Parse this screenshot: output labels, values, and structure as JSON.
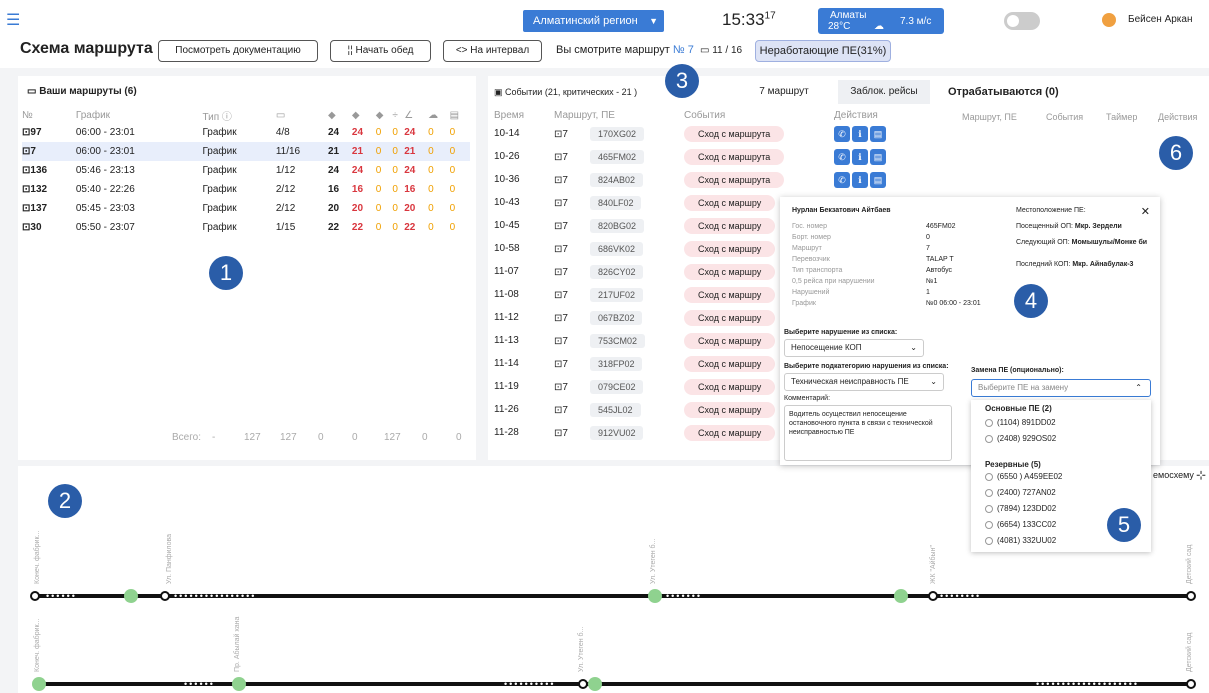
{
  "header": {
    "region": "Алматинский регион",
    "time": "15:33",
    "seconds": "17",
    "weather_city": "Алматы",
    "weather_temp": "28°C",
    "wind": "7.3 м/с",
    "user": "Бейсен Аркан"
  },
  "toolbar": {
    "title": "Схема маршрута",
    "docs": "Посмотреть документацию",
    "lunch": "Начать обед",
    "interval": "На интервал",
    "viewing": "Вы смотрите маршрут",
    "route_no": "№ 7",
    "counter": "11 / 16",
    "nonwork": "Неработающие ПЕ(31%)"
  },
  "routes": {
    "title": "Ваши маршруты (6)",
    "headers": [
      "№",
      "График",
      "Тип",
      "",
      "",
      "",
      "",
      "",
      "",
      "",
      ""
    ],
    "rows": [
      {
        "n": "97",
        "g": "06:00 - 23:01",
        "t": "График",
        "a": "4/8",
        "b": "24",
        "c": "24",
        "d": "0",
        "e": "0",
        "f": "24",
        "h": "0",
        "i": "0"
      },
      {
        "n": "7",
        "g": "06:00 - 23:01",
        "t": "График",
        "a": "11/16",
        "b": "21",
        "c": "21",
        "d": "0",
        "e": "0",
        "f": "21",
        "h": "0",
        "i": "0"
      },
      {
        "n": "136",
        "g": "05:46 - 23:13",
        "t": "График",
        "a": "1/12",
        "b": "24",
        "c": "24",
        "d": "0",
        "e": "0",
        "f": "24",
        "h": "0",
        "i": "0"
      },
      {
        "n": "132",
        "g": "05:40 - 22:26",
        "t": "График",
        "a": "2/12",
        "b": "16",
        "c": "16",
        "d": "0",
        "e": "0",
        "f": "16",
        "h": "0",
        "i": "0"
      },
      {
        "n": "137",
        "g": "05:45 - 23:03",
        "t": "График",
        "a": "2/12",
        "b": "20",
        "c": "20",
        "d": "0",
        "e": "0",
        "f": "20",
        "h": "0",
        "i": "0"
      },
      {
        "n": "30",
        "g": "05:50 - 23:07",
        "t": "График",
        "a": "1/15",
        "b": "22",
        "c": "22",
        "d": "0",
        "e": "0",
        "f": "22",
        "h": "0",
        "i": "0"
      }
    ],
    "totals": [
      "Всего:",
      "-",
      "127",
      "127",
      "0",
      "0",
      "127",
      "0",
      "0"
    ]
  },
  "events": {
    "title": "Событии (21, критических - 21 )",
    "tabs": [
      "7 маршрут",
      "Заблок. рейсы"
    ],
    "headers": [
      "Время",
      "Маршрут, ПЕ",
      "События",
      "Действия"
    ],
    "rows": [
      [
        "10-14",
        "7",
        "170XG02"
      ],
      [
        "10-26",
        "7",
        "465FM02"
      ],
      [
        "10-36",
        "7",
        "824AB02"
      ],
      [
        "10-43",
        "7",
        "840LF02"
      ],
      [
        "10-45",
        "7",
        "820BG02"
      ],
      [
        "10-58",
        "7",
        "686VK02"
      ],
      [
        "11-07",
        "7",
        "826CY02"
      ],
      [
        "11-08",
        "7",
        "217UF02"
      ],
      [
        "11-12",
        "7",
        "067BZ02"
      ],
      [
        "11-13",
        "7",
        "753CM02"
      ],
      [
        "11-14",
        "7",
        "318FP02"
      ],
      [
        "11-19",
        "7",
        "079CE02"
      ],
      [
        "11-26",
        "7",
        "545JL02"
      ],
      [
        "11-28",
        "7",
        "912VU02"
      ]
    ],
    "event_label": "Сход с маршрута",
    "event_short": "Сход с маршру"
  },
  "processing": {
    "title": "Отрабатываются (0)",
    "headers": [
      "Маршрут, ПЕ",
      "События",
      "Таймер",
      "Действия"
    ]
  },
  "popup": {
    "name": "Нурлан Бекзатович Айтбаев",
    "fields": [
      [
        "Гос. номер",
        "465FM02"
      ],
      [
        "Борт. номер",
        "0"
      ],
      [
        "Маршрут",
        "7"
      ],
      [
        "Перевозчик",
        "TALAP T"
      ],
      [
        "Тип транспорта",
        "Автобус"
      ],
      [
        "0,5 рейса при нарушении",
        "№1"
      ],
      [
        "Нарушений",
        "1"
      ],
      [
        "График",
        "№0 06:00 - 23:01"
      ]
    ],
    "loc": [
      [
        "Местоположение ПЕ:",
        ""
      ],
      [
        "Посещенный ОП:",
        "Мкр. Зердели"
      ],
      [
        "Следующий ОП:",
        "Момышулы/Монке би"
      ],
      [
        "Последний КОП:",
        "Мкр. Айнабулак-3"
      ]
    ],
    "violation_label": "Выберите нарушение из списка:",
    "violation": "Непосещение КОП",
    "sub_label": "Выберите подкатегорию нарушения из списка:",
    "sub": "Техническая неисправность ПЕ",
    "comment_label": "Комментарий:",
    "comment": "Водитель осуществил непосещение остановочного пункта в связи с технической неисправностью ПЕ",
    "replace_label": "Замена ПЕ (опционально):",
    "replace_placeholder": "Выберите ПЕ на замену"
  },
  "dropdown": {
    "main_title": "Основные ПЕ (2)",
    "main": [
      "(1104) 891DD02",
      "(2408) 929OS02"
    ],
    "reserve_title": "Резервные (5)",
    "reserve": [
      "(6550 ) A459EE02",
      "(2400) 727AN02",
      "(7894) 123DD02",
      "(6654) 133CC02",
      "(4081) 332UU02"
    ]
  },
  "timeline": {
    "label": "емосхему",
    "stops_top": [
      "Конеч. фабрик...",
      "Ул. Панфилова",
      "Ул. Утеген б...",
      "ЖК \"Айбын\"",
      "Детский сад"
    ],
    "stops_bottom": [
      "Конеч. фабрик...",
      "Пр. Абылай хана",
      "Ул. Утеген б...",
      "Детский сад"
    ]
  },
  "markers": [
    "1",
    "2",
    "3",
    "4",
    "5",
    "6"
  ]
}
